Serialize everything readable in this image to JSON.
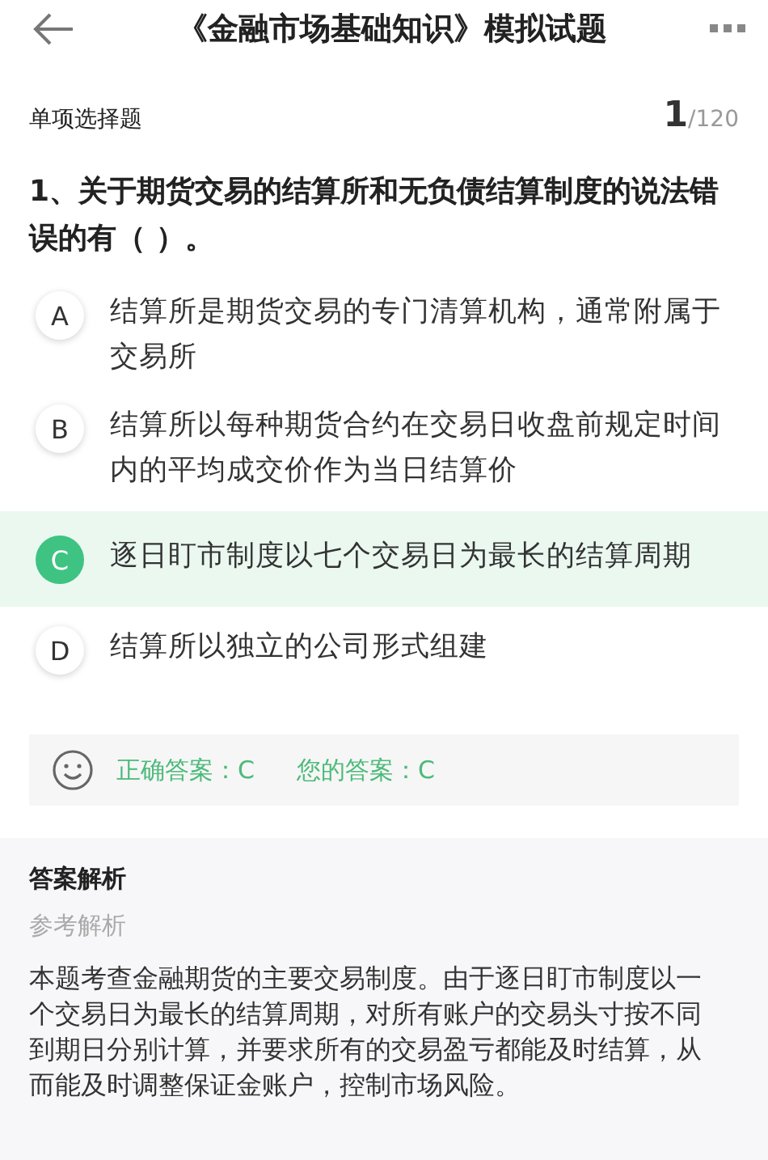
{
  "header": {
    "title": "《金融市场基础知识》模拟试题"
  },
  "question_type": "单项选择题",
  "progress": {
    "current": "1",
    "total": "/120"
  },
  "question": "1、关于期货交易的结算所和无负债结算制度的说法错误的有（   ）。",
  "options": [
    {
      "letter": "A",
      "text": "结算所是期货交易的专门清算机构，通常附属于交易所",
      "selected": false
    },
    {
      "letter": "B",
      "text": "结算所以每种期货合约在交易日收盘前规定时间内的平均成交价作为当日结算价",
      "selected": false
    },
    {
      "letter": "C",
      "text": "逐日盯市制度以七个交易日为最长的结算周期",
      "selected": true
    },
    {
      "letter": "D",
      "text": "结算所以独立的公司形式组建",
      "selected": false
    }
  ],
  "answer": {
    "correct": "正确答案：C",
    "yours": "您的答案：C"
  },
  "analysis": {
    "title": "答案解析",
    "subtitle": "参考解析",
    "body": "本题考查金融期货的主要交易制度。由于逐日盯市制度以一个交易日为最长的结算周期，对所有账户的交易头寸按不同到期日分别计算，并要求所有的交易盈亏都能及时结算，从而能及时调整保证金账户，控制市场风险。"
  }
}
